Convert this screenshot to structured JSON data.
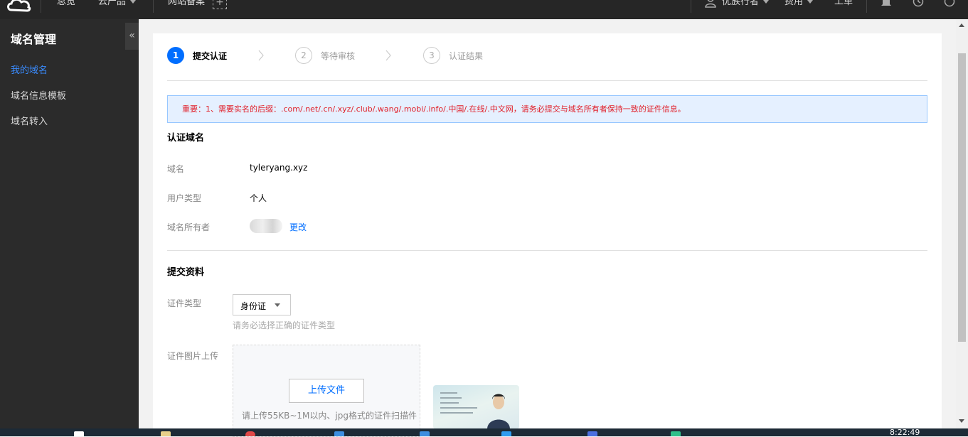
{
  "topbar": {
    "nav": [
      "总览",
      "云产品",
      "网站备案"
    ],
    "plus": "+",
    "user": "优族行者",
    "billing": "费用",
    "ticket": "工单"
  },
  "sidebar": {
    "title": "域名管理",
    "collapse": "«",
    "items": [
      {
        "label": "我的域名",
        "active": true
      },
      {
        "label": "域名信息模板",
        "active": false
      },
      {
        "label": "域名转入",
        "active": false
      }
    ]
  },
  "steps": [
    {
      "num": "1",
      "label": "提交认证",
      "active": true
    },
    {
      "num": "2",
      "label": "等待审核",
      "active": false
    },
    {
      "num": "3",
      "label": "认证结果",
      "active": false
    }
  ],
  "notice": "重要：1、需要实名的后缀：.com/.net/.cn/.xyz/.club/.wang/.mobi/.info/.中国/.在线/.中文网，请务必提交与域名所有者保持一致的证件信息。",
  "domain_section": {
    "title": "认证域名",
    "domain_label": "域名",
    "domain_value": "tyleryang.xyz",
    "user_type_label": "用户类型",
    "user_type_value": "个人",
    "owner_label": "域名所有者",
    "change_link": "更改"
  },
  "submit_section": {
    "title": "提交资料",
    "cert_type_label": "证件类型",
    "cert_type_value": "身份证",
    "cert_type_hint": "请务必选择正确的证件类型",
    "upload_label": "证件图片上传",
    "upload_button": "上传文件",
    "upload_desc": "请上传55KB~1M以内、jpg格式的证件扫描件"
  },
  "taskbar": {
    "clock": "8:22:49"
  },
  "colors": {
    "primary": "#006eff",
    "topbar_bg": "#262626",
    "sidebar_bg": "#2b2b2b",
    "notice_text": "#e1202a",
    "notice_bg": "#e5f0ff"
  }
}
